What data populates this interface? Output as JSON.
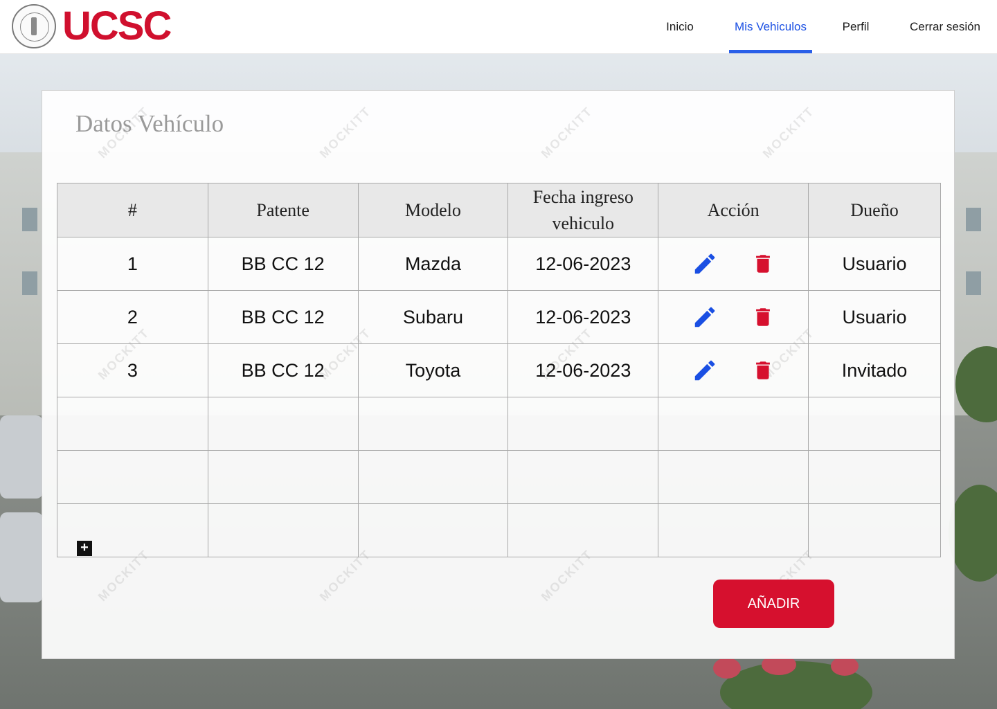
{
  "header": {
    "logo_text": "UCSC",
    "nav": [
      {
        "label": "Inicio",
        "active": false
      },
      {
        "label": "Mis Vehiculos",
        "active": true
      },
      {
        "label": "Perfil",
        "active": false
      },
      {
        "label": "Cerrar sesión",
        "active": false
      }
    ]
  },
  "card": {
    "title": "Datos Vehículo",
    "watermark_text": "MOCKITT"
  },
  "table": {
    "columns": [
      "#",
      "Patente",
      "Modelo",
      "Fecha ingreso vehiculo",
      "Acción",
      "Dueño"
    ],
    "rows": [
      {
        "num": "1",
        "patente": "BB CC 12",
        "modelo": "Mazda",
        "fecha": "12-06-2023",
        "dueno": "Usuario"
      },
      {
        "num": "2",
        "patente": "BB CC 12",
        "modelo": "Subaru",
        "fecha": "12-06-2023",
        "dueno": "Usuario"
      },
      {
        "num": "3",
        "patente": "BB CC 12",
        "modelo": "Toyota",
        "fecha": "12-06-2023",
        "dueno": "Invitado"
      }
    ],
    "empty_rows": 3
  },
  "add_row_icon": "+",
  "add_button": {
    "label": "AÑADIR"
  },
  "icons": {
    "edit": "pencil-icon",
    "delete": "trash-icon"
  },
  "colors": {
    "accent": "#1a4fe3",
    "brand": "#d0102e",
    "edit_icon": "#1a4fe3",
    "delete_icon": "#d6102e"
  }
}
